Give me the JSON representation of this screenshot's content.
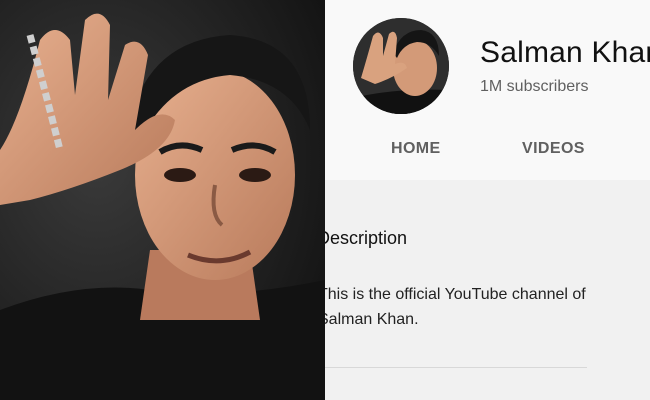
{
  "channel": {
    "name": "Salman Khan",
    "subscribers": "1M subscribers"
  },
  "tabs": [
    {
      "label": "HOME"
    },
    {
      "label": "VIDEOS"
    }
  ],
  "about": {
    "heading": "Description",
    "text": "This is the official YouTube channel of Salman Khan."
  },
  "colors": {
    "header_bg": "#f9f9f9",
    "body_bg": "#f1f1f1",
    "shirt": "#111111"
  }
}
